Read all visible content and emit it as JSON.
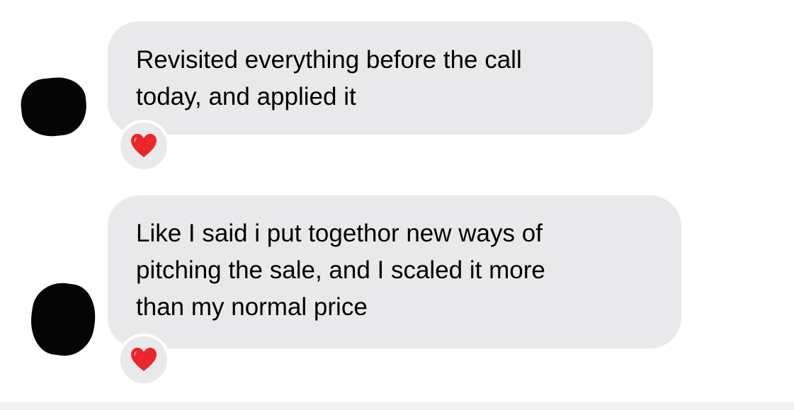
{
  "messages": [
    {
      "lines": [
        "Revisited everything before the call",
        "today, and applied it"
      ],
      "reaction": "heart-icon"
    },
    {
      "lines": [
        "Like I said i put togethor new ways of",
        "pitching the sale, and I scaled it more",
        "than my normal price"
      ],
      "reaction": "heart-icon"
    }
  ],
  "colors": {
    "bubble_background": "#e9e9eb",
    "text": "#000000",
    "reaction_heart": "#e8262c",
    "avatar_redaction": "#050505"
  }
}
